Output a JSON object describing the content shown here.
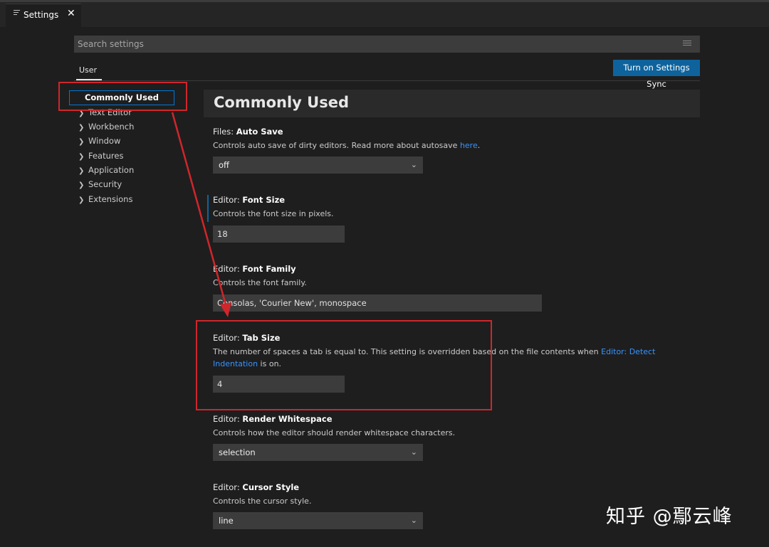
{
  "tab": {
    "label": "Settings",
    "icon": "settings-list-icon",
    "close": "✕"
  },
  "search": {
    "placeholder": "Search settings"
  },
  "scope": {
    "user_tab": "User",
    "sync_button": "Turn on Settings Sync"
  },
  "toc": {
    "active": "Commonly Used",
    "items": [
      {
        "label": "Text Editor"
      },
      {
        "label": "Workbench"
      },
      {
        "label": "Window"
      },
      {
        "label": "Features"
      },
      {
        "label": "Application"
      },
      {
        "label": "Security"
      },
      {
        "label": "Extensions"
      }
    ]
  },
  "section": {
    "title": "Commonly Used"
  },
  "settings": {
    "auto_save": {
      "category": "Files: ",
      "name": "Auto Save",
      "desc": "Controls auto save of dirty editors. Read more about autosave ",
      "link": "here",
      "desc_end": ".",
      "value": "off"
    },
    "font_size": {
      "category": "Editor: ",
      "name": "Font Size",
      "desc": "Controls the font size in pixels.",
      "value": "18"
    },
    "font_family": {
      "category": "Editor: ",
      "name": "Font Family",
      "desc": "Controls the font family.",
      "value": "Consolas, 'Courier New', monospace"
    },
    "tab_size": {
      "category": "Editor: ",
      "name": "Tab Size",
      "desc": "The number of spaces a tab is equal to. This setting is overridden based on the file contents when ",
      "link": "Editor: Detect Indentation",
      "desc_end": " is on.",
      "value": "4"
    },
    "render_whitespace": {
      "category": "Editor: ",
      "name": "Render Whitespace",
      "desc": "Controls how the editor should render whitespace characters.",
      "value": "selection"
    },
    "cursor_style": {
      "category": "Editor: ",
      "name": "Cursor Style",
      "desc": "Controls the cursor style.",
      "value": "line"
    }
  },
  "watermark": "知乎 @鄢云峰",
  "colors": {
    "accent": "#0e639c",
    "annotation": "#d0262b",
    "link": "#3794ff"
  }
}
